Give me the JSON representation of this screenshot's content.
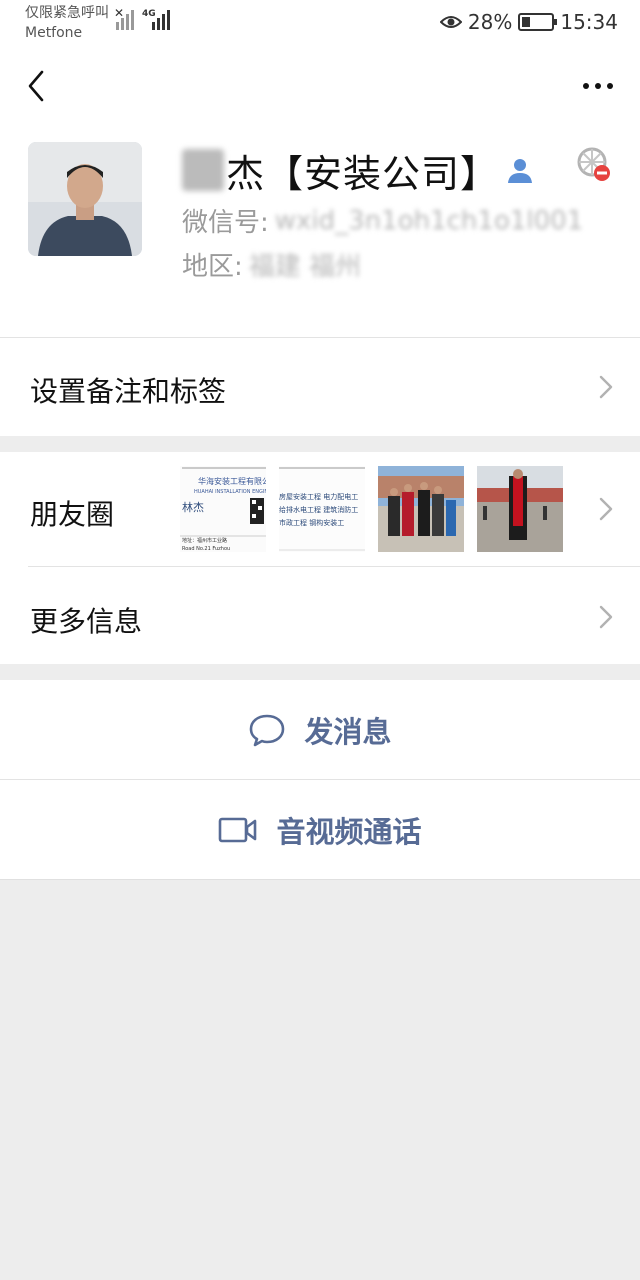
{
  "status_bar": {
    "carrier_line1": "仅限紧急呼叫",
    "carrier_line2": "Metfone",
    "network_badge": "4G",
    "battery_percent": "28%",
    "battery_level": 0.28,
    "time": "15:34",
    "icons": [
      "signal-off-icon",
      "signal-icon",
      "eye-icon",
      "battery-icon"
    ]
  },
  "nav": {
    "back_icon": "back-chevron-icon",
    "more_icon": "more-dots-icon"
  },
  "profile": {
    "name": "杰【安装公司】",
    "wechat_id_label": "微信号:",
    "wechat_id_value": "wxid_3n1oh1ch1o1l001",
    "region_label": "地区:",
    "region_value": "福建  福州",
    "icons": [
      "person-badge-icon",
      "moments-blocked-icon"
    ]
  },
  "cells": {
    "remark_label": "设置备注和标签",
    "moments_label": "朋友圈",
    "more_info_label": "更多信息",
    "moment_thumbs": [
      {
        "kind": "business-card-front",
        "title": "华海安装工程有限公司",
        "name": "林杰"
      },
      {
        "kind": "business-card-back",
        "lines": [
          "房屋安装工程 电力配电工",
          "给排水电工程 建筑消防工",
          "市政工程 钢构安装工"
        ]
      },
      {
        "kind": "photo-dance"
      },
      {
        "kind": "photo-red-scarf"
      }
    ]
  },
  "actions": {
    "message_label": "发消息",
    "call_label": "音视频通话",
    "accent_color": "#576b95"
  }
}
